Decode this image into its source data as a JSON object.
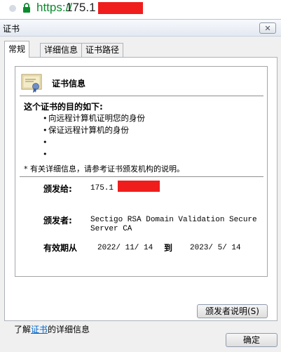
{
  "browser": {
    "scheme": "https://",
    "host_visible": "175.1"
  },
  "dialog": {
    "title": "证书",
    "close_symbol": "✕",
    "tabs": [
      {
        "label": "常规"
      },
      {
        "label": "详细信息"
      },
      {
        "label": "证书路径"
      }
    ],
    "cert_info": {
      "heading": "证书信息",
      "purpose_title": "这个证书的目的如下:",
      "purposes": [
        "向远程计算机证明您的身份",
        "保证远程计算机的身份",
        "",
        ""
      ],
      "note": "* 有关详细信息，请参考证书颁发机构的说明。",
      "issued_to_label": "颁发给:",
      "issued_to_value": "175.1",
      "issued_by_label": "颁发者:",
      "issued_by_line1": "Sectigo RSA Domain Validation Secure",
      "issued_by_line2": "Server CA",
      "validity_label": "有效期从",
      "valid_from": "2022/ 11/ 14",
      "to_label": "到",
      "valid_to": "2023/ 5/ 14"
    },
    "issuer_statement_button": "颁发者说明(S)",
    "learn_prefix": "了解",
    "learn_link": "证书",
    "learn_suffix": "的详细信息",
    "ok_button": "确定"
  }
}
